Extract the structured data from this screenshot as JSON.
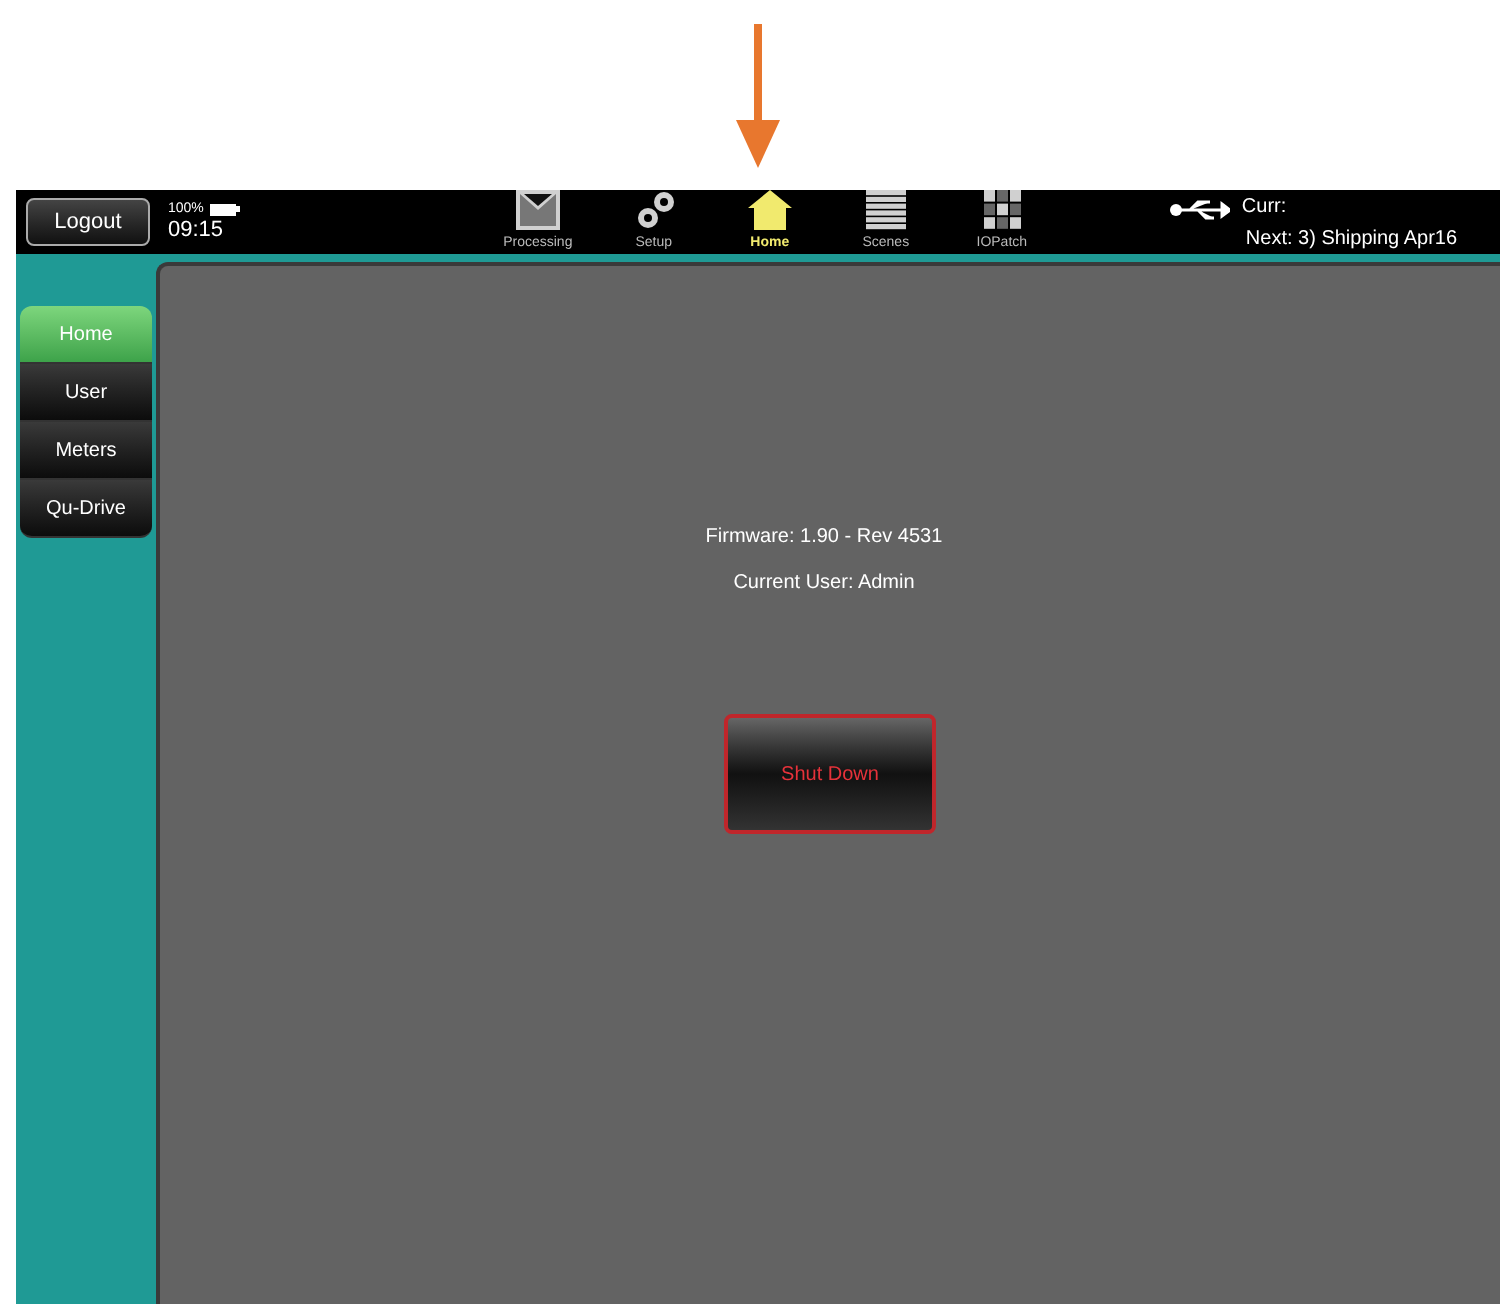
{
  "annotation": {
    "kind": "arrow"
  },
  "top_bar": {
    "logout": "Logout",
    "battery": "100%",
    "time": "09:15",
    "nav": [
      {
        "kind": "processing",
        "label": "Processing",
        "selected": false
      },
      {
        "kind": "setup",
        "label": "Setup",
        "selected": false
      },
      {
        "kind": "home",
        "label": "Home",
        "selected": true
      },
      {
        "kind": "scenes",
        "label": "Scenes",
        "selected": false
      },
      {
        "kind": "iopatch",
        "label": "IOPatch",
        "selected": false
      }
    ],
    "current": "Curr:",
    "next": "Next: 3) Shipping Apr16"
  },
  "sidebar": {
    "items": [
      {
        "label": "Home",
        "selected": true
      },
      {
        "label": "User",
        "selected": false
      },
      {
        "label": "Meters",
        "selected": false
      },
      {
        "label": "Qu-Drive",
        "selected": false
      }
    ]
  },
  "content": {
    "firmware": "Firmware: 1.90 - Rev 4531",
    "user": "Current User: Admin",
    "shutdown": "Shut Down"
  }
}
